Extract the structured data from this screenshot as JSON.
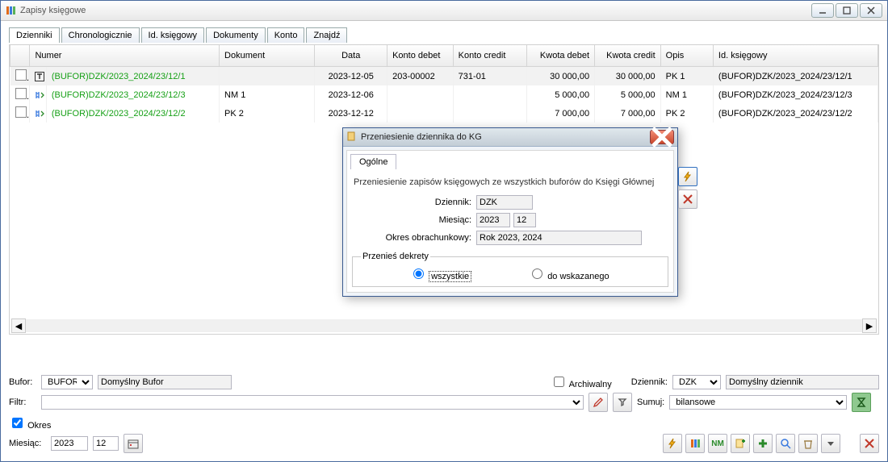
{
  "window": {
    "title": "Zapisy księgowe"
  },
  "tabs": [
    "Dzienniki",
    "Chronologicznie",
    "Id. księgowy",
    "Dokumenty",
    "Konto",
    "Znajdź"
  ],
  "columns": [
    "Numer",
    "Dokument",
    "Data",
    "Konto debet",
    "Konto credit",
    "Kwota debet",
    "Kwota credit",
    "Opis",
    "Id. księgowy"
  ],
  "rows": [
    {
      "numer": "(BUFOR)DZK/2023_2024/23/12/1",
      "dokument": "",
      "data": "2023-12-05",
      "kdebet": "203-00002",
      "kcredit": "731-01",
      "qdebet": "30 000,00",
      "qcredit": "30 000,00",
      "opis": "PK 1",
      "id": "(BUFOR)DZK/2023_2024/23/12/1",
      "rowicon": "T"
    },
    {
      "numer": "(BUFOR)DZK/2023_2024/23/12/3",
      "dokument": "NM 1",
      "data": "2023-12-06",
      "kdebet": "",
      "kcredit": "",
      "qdebet": "5 000,00",
      "qcredit": "5 000,00",
      "opis": "NM 1",
      "id": "(BUFOR)DZK/2023_2024/23/12/3",
      "rowicon": "#"
    },
    {
      "numer": "(BUFOR)DZK/2023_2024/23/12/2",
      "dokument": "PK 2",
      "data": "2023-12-12",
      "kdebet": "",
      "kcredit": "",
      "qdebet": "7 000,00",
      "qcredit": "7 000,00",
      "opis": "PK 2",
      "id": "(BUFOR)DZK/2023_2024/23/12/2",
      "rowicon": "#"
    }
  ],
  "bottom": {
    "bufor_label": "Bufor:",
    "bufor_value": "BUFOR",
    "bufor_desc": "Domyślny Bufor",
    "filtr_label": "Filtr:",
    "filtr_value": "",
    "archiwalny_label": "Archiwalny",
    "dziennik_label": "Dziennik:",
    "dziennik_value": "DZK",
    "dziennik_desc": "Domyślny dziennik",
    "sumuj_label": "Sumuj:",
    "sumuj_value": "bilansowe",
    "okres_label": "Okres",
    "okres_checked": true,
    "miesiac_label": "Miesiąc:",
    "rok": "2023",
    "mies": "12"
  },
  "dialog": {
    "title": "Przeniesienie dziennika do KG",
    "tab": "Ogólne",
    "desc": "Przeniesienie zapisów księgowych ze wszystkich buforów do Księgi Głównej",
    "dziennik_label": "Dziennik:",
    "dziennik_value": "DZK",
    "miesiac_label": "Miesiąc:",
    "rok": "2023",
    "mies": "12",
    "okres_label": "Okres obrachunkowy:",
    "okres_value": "Rok 2023, 2024",
    "legend": "Przenieś dekrety",
    "opt_all": "wszystkie",
    "opt_sel": "do wskazanego"
  }
}
